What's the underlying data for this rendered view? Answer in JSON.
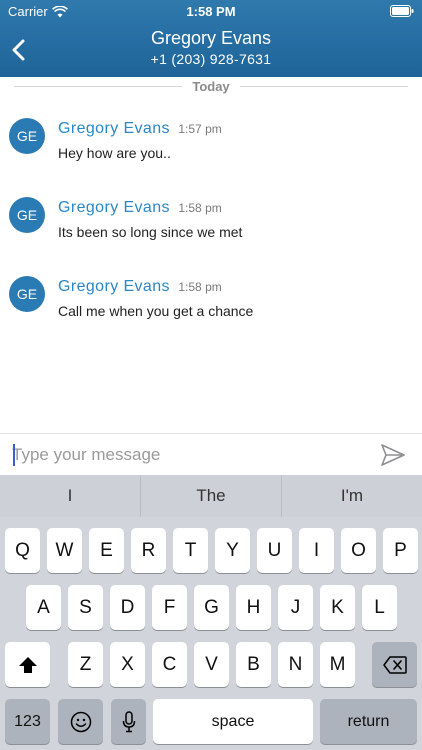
{
  "status_bar": {
    "carrier": "Carrier",
    "time": "1:58 PM"
  },
  "header": {
    "name": "Gregory Evans",
    "phone": "+1 (203) 928-7631"
  },
  "chat": {
    "date_label": "Today",
    "messages": [
      {
        "initials": "GE",
        "sender": "Gregory Evans",
        "time": "1:57 pm",
        "text": "Hey how are you.."
      },
      {
        "initials": "GE",
        "sender": "Gregory Evans",
        "time": "1:58 pm",
        "text": "Its been so long since we met"
      },
      {
        "initials": "GE",
        "sender": "Gregory Evans",
        "time": "1:58 pm",
        "text": "Call me when you get a chance"
      }
    ]
  },
  "composer": {
    "placeholder": "Type your message",
    "value": ""
  },
  "keyboard": {
    "suggestions": [
      "I",
      "The",
      "I'm"
    ],
    "row1": [
      "Q",
      "W",
      "E",
      "R",
      "T",
      "Y",
      "U",
      "I",
      "O",
      "P"
    ],
    "row2": [
      "A",
      "S",
      "D",
      "F",
      "G",
      "H",
      "J",
      "K",
      "L"
    ],
    "row3": [
      "Z",
      "X",
      "C",
      "V",
      "B",
      "N",
      "M"
    ],
    "numbers_label": "123",
    "space_label": "space",
    "return_label": "return"
  },
  "icons": {
    "wifi": "wifi-icon",
    "battery": "battery-icon",
    "back": "chevron-left-icon",
    "send": "send-icon",
    "shift": "shift-icon",
    "backspace": "backspace-icon",
    "emoji": "emoji-icon",
    "mic": "microphone-icon"
  },
  "colors": {
    "header": "#1e6499",
    "sender": "#2a88c8",
    "avatar": "#2a7ab4",
    "keyboard": "#d1d4da"
  }
}
